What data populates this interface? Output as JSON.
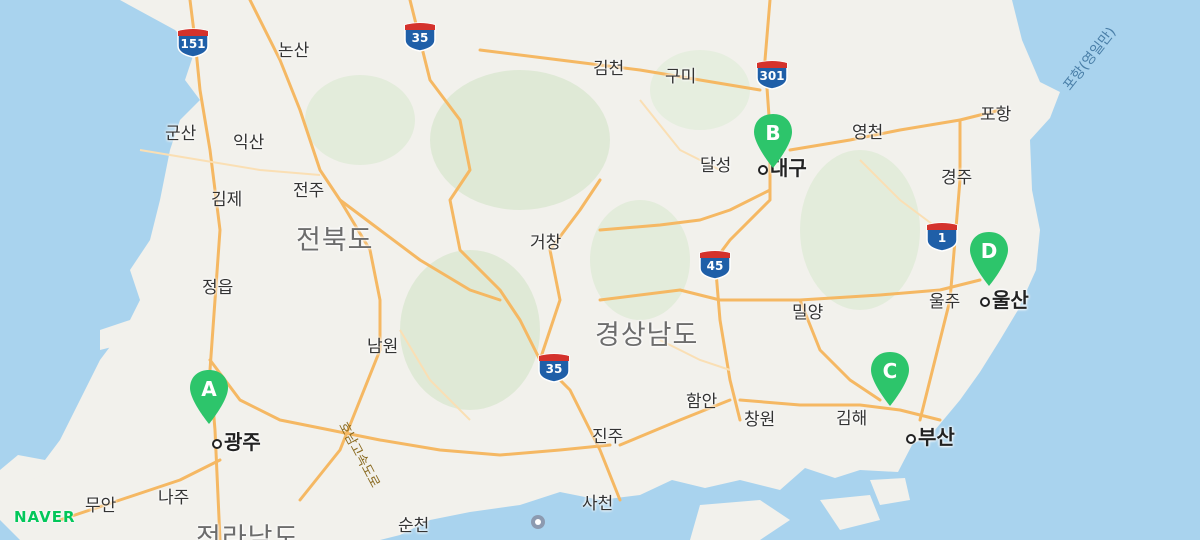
{
  "map": {
    "logo": "NAVER",
    "sea_label": "포항(영일만)",
    "road_label": "호남고속도로",
    "provinces": [
      "전북도",
      "경상남도",
      "전라남도"
    ],
    "major_cities": [
      "대구",
      "울산",
      "광주",
      "부산"
    ],
    "towns": [
      "논산",
      "김천",
      "구미",
      "포항",
      "군산",
      "익산",
      "영천",
      "달성",
      "전주",
      "김제",
      "경주",
      "거창",
      "정읍",
      "밀양",
      "울주",
      "남원",
      "함안",
      "창원",
      "김해",
      "진주",
      "무안",
      "나주",
      "사천",
      "순천"
    ],
    "highway_shields": [
      "151",
      "35",
      "301",
      "1",
      "45",
      "35"
    ],
    "markers": [
      "A",
      "B",
      "C",
      "D"
    ],
    "colors": {
      "marker": "#2dc56b",
      "shield_top": "#d4322c",
      "shield_bottom": "#1f5fa8",
      "road": "#f5b863",
      "water": "#a9d3ee",
      "land": "#f2f1ec",
      "logo": "#03c75a"
    }
  }
}
